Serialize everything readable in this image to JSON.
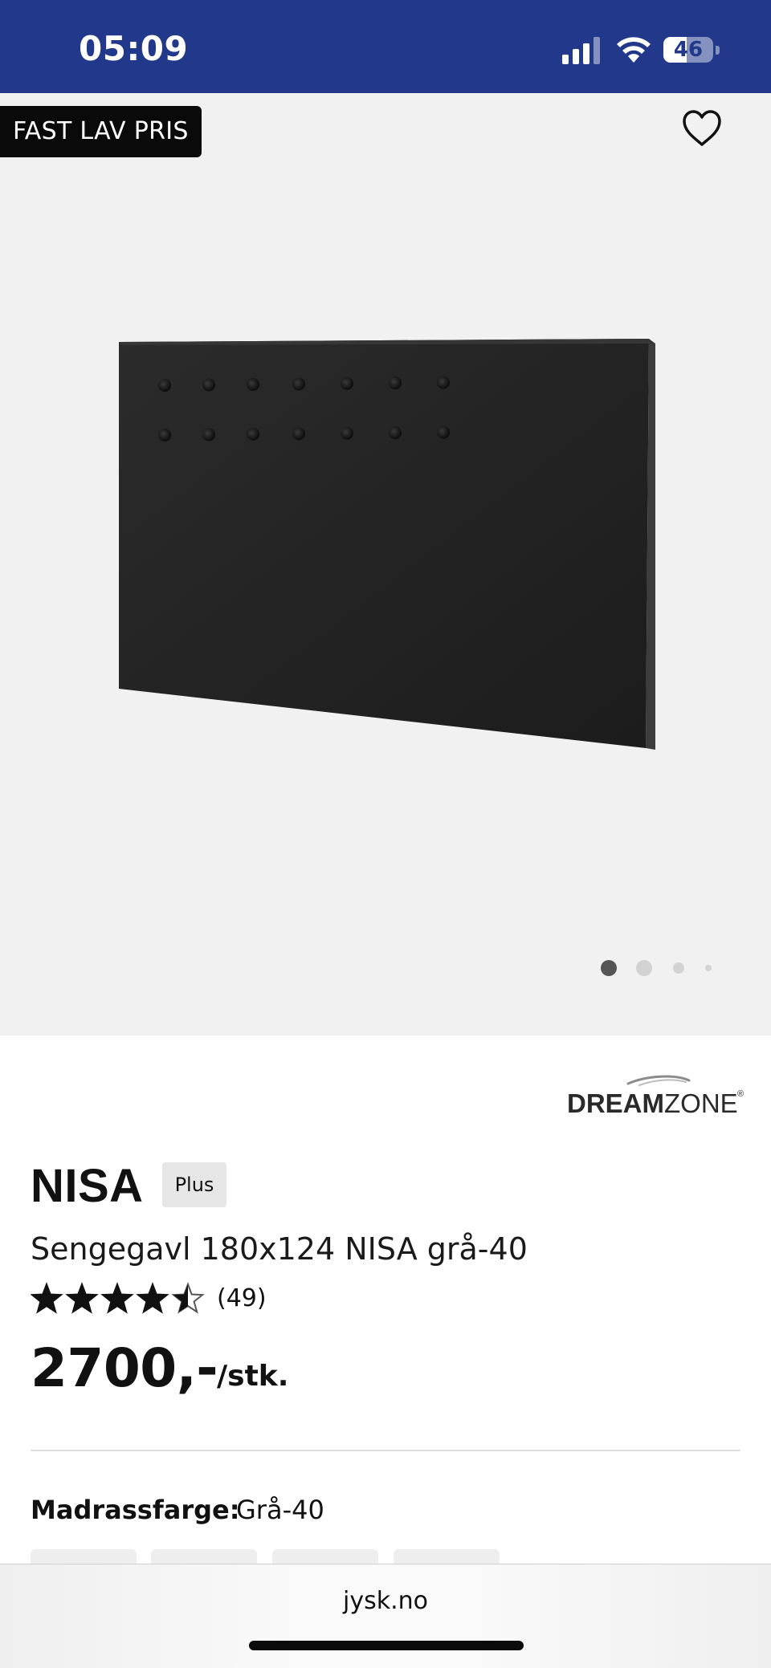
{
  "status_bar": {
    "time": "05:09",
    "battery_level": "46",
    "battery_fraction": 0.46,
    "bg_color": "#22388a",
    "icons": [
      "cellular-signal-icon",
      "wifi-icon",
      "battery-icon"
    ]
  },
  "gallery": {
    "badge": "FAST LAV PRIS",
    "favorite_icon": "heart-outline-icon",
    "image_subject": "headboard",
    "image_count": 4,
    "active_index": 0,
    "bg_color": "#f2f1f1"
  },
  "product": {
    "brand": "DREAMZONE",
    "brand_bold": "DREAM",
    "brand_light": "ZONE",
    "name": "NISA",
    "tier_badge": "Plus",
    "description": "Sengegavl 180x124 NISA grå-40",
    "rating": 4.5,
    "review_count": "(49)",
    "price": "2700,-",
    "unit": "/stk.",
    "attribute": {
      "label": "Madrassfarge:",
      "value": "Grå-40"
    }
  },
  "browser": {
    "url": "jysk.no"
  }
}
